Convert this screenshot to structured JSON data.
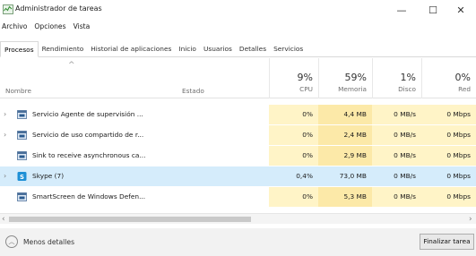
{
  "window": {
    "title": "Administrador de tareas",
    "minimize_glyph": "—",
    "maximize_glyph": "☐",
    "close_glyph": "✕"
  },
  "menu": [
    "Archivo",
    "Opciones",
    "Vista"
  ],
  "tabs": [
    {
      "label": "Procesos",
      "active": true
    },
    {
      "label": "Rendimiento",
      "active": false
    },
    {
      "label": "Historial de aplicaciones",
      "active": false
    },
    {
      "label": "Inicio",
      "active": false
    },
    {
      "label": "Usuarios",
      "active": false
    },
    {
      "label": "Detalles",
      "active": false
    },
    {
      "label": "Servicios",
      "active": false
    }
  ],
  "columns": {
    "name": "Nombre",
    "status": "Estado",
    "cpu": {
      "percent": "9%",
      "label": "CPU"
    },
    "memory": {
      "percent": "59%",
      "label": "Memoria"
    },
    "disk": {
      "percent": "1%",
      "label": "Disco"
    },
    "network": {
      "percent": "0%",
      "label": "Red"
    }
  },
  "processes": [
    {
      "name": "Servicio Agente de supervisión ...",
      "expandable": true,
      "icon": "service-window-icon",
      "cpu": "0%",
      "memory": "4,4 MB",
      "disk": "0 MB/s",
      "network": "0 Mbps",
      "selected": false
    },
    {
      "name": "Servicio de uso compartido de r...",
      "expandable": true,
      "icon": "service-window-icon",
      "cpu": "0%",
      "memory": "2,4 MB",
      "disk": "0 MB/s",
      "network": "0 Mbps",
      "selected": false
    },
    {
      "name": "Sink to receive asynchronous ca...",
      "expandable": false,
      "icon": "service-window-icon",
      "cpu": "0%",
      "memory": "2,9 MB",
      "disk": "0 MB/s",
      "network": "0 Mbps",
      "selected": false
    },
    {
      "name": "Skype (7)",
      "expandable": true,
      "icon": "skype-icon",
      "cpu": "0,4%",
      "memory": "73,0 MB",
      "disk": "0 MB/s",
      "network": "0 Mbps",
      "selected": true
    },
    {
      "name": "SmartScreen de Windows Defen...",
      "expandable": false,
      "icon": "service-window-icon",
      "cpu": "0%",
      "memory": "5,3 MB",
      "disk": "0 MB/s",
      "network": "0 Mbps",
      "selected": false
    }
  ],
  "footer": {
    "less_details": "Menos detalles",
    "end_task": "Finalizar tarea"
  },
  "colors": {
    "cpu_heat": "#fff4c7",
    "memory_heat": "#fce9a8",
    "selected_row": "#d5ecfb"
  }
}
